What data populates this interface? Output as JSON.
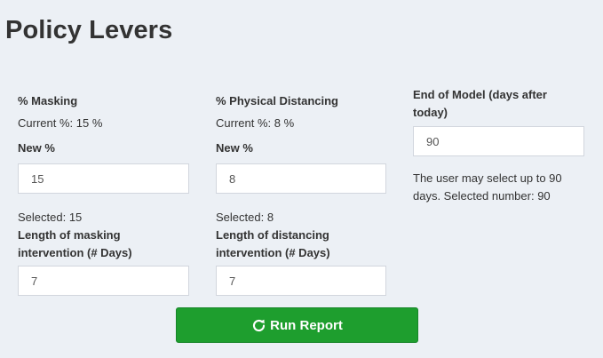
{
  "page": {
    "title": "Policy Levers"
  },
  "masking": {
    "label": "% Masking",
    "current": "Current %: 15 %",
    "new_label": "New %",
    "new_value": "15",
    "selected": "Selected: 15",
    "length_label": "Length of masking intervention (# Days)",
    "length_value": "7"
  },
  "distancing": {
    "label": "% Physical Distancing",
    "current": "Current %: 8 %",
    "new_label": "New %",
    "new_value": "8",
    "selected": "Selected: 8",
    "length_label": "Length of distancing intervention (# Days)",
    "length_value": "7"
  },
  "end_model": {
    "label": "End of Model (days after today)",
    "value": "90",
    "help": "The user may select up to 90 days. Selected number: 90"
  },
  "run_button": {
    "label": "Run Report",
    "icon": "refresh-icon",
    "color": "#1e9e2e"
  },
  "colors": {
    "background": "#ecf0f5",
    "text": "#333333",
    "input_border": "#d2d6de"
  }
}
